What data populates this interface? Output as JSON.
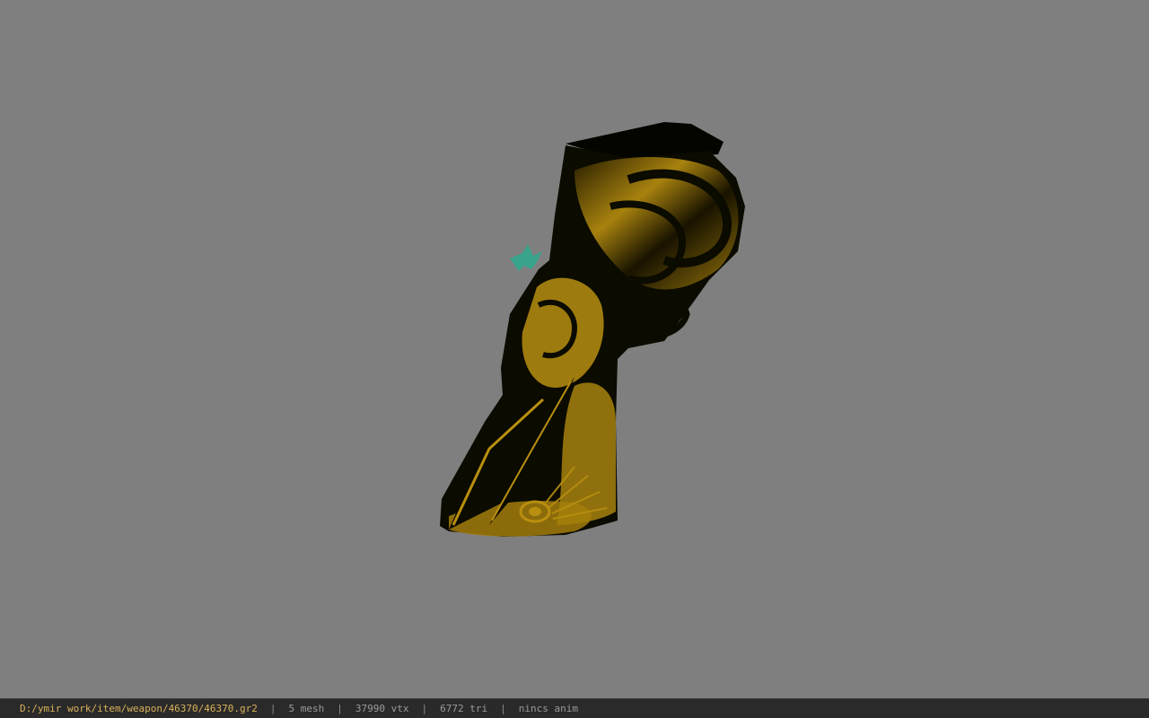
{
  "viewer": {
    "background_color": "#7f7f7f",
    "model_colors": {
      "gold": "#b98f10",
      "dark": "#0b0b00",
      "gem": "#3aa38c"
    }
  },
  "status": {
    "file_path": "D:/ymir work/item/weapon/46370/46370.gr2",
    "separator": "|",
    "mesh": "5 mesh",
    "vertices": "37990 vtx",
    "triangles": "6772 tri",
    "anim": "nincs anim"
  }
}
